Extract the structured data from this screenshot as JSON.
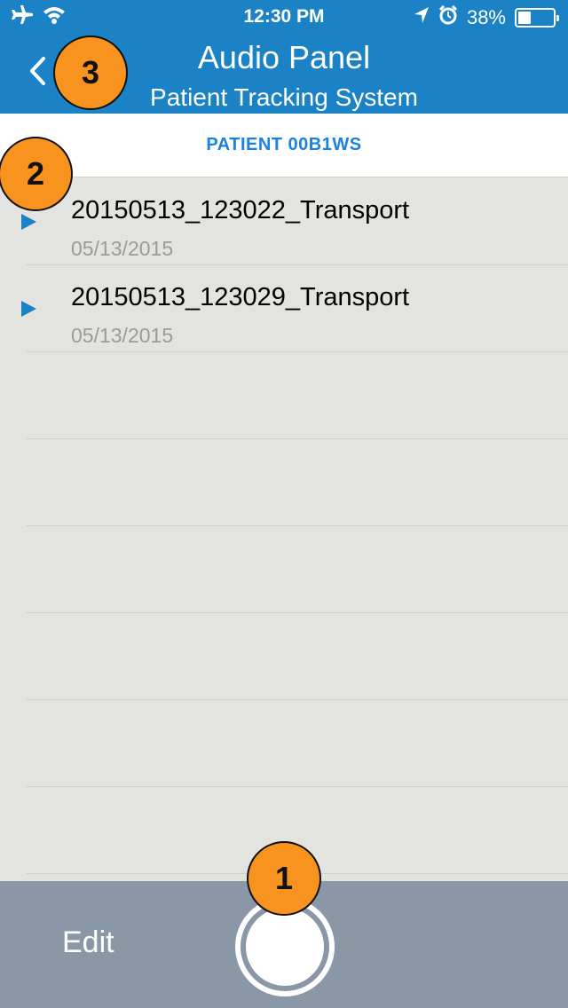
{
  "status_bar": {
    "time": "12:30 PM",
    "battery_percent_label": "38%",
    "battery_level": 0.38,
    "icons": [
      "airplane-icon",
      "wifi-icon",
      "location-icon",
      "alarm-icon",
      "battery-icon"
    ]
  },
  "nav": {
    "title": "Audio Panel",
    "subtitle": "Patient Tracking System",
    "back_icon": "chevron-left-icon"
  },
  "patient": {
    "label": "PATIENT 00B1WS"
  },
  "recordings": [
    {
      "name": "20150513_123022_Transport",
      "date": "05/13/2015"
    },
    {
      "name": "20150513_123029_Transport",
      "date": "05/13/2015"
    }
  ],
  "toolbar": {
    "edit_label": "Edit",
    "record_icon": "record-button-icon"
  },
  "callouts": [
    "1",
    "2",
    "3"
  ],
  "colors": {
    "header": "#1a82c5",
    "accent": "#1a82e0",
    "toolbar": "#8a97a6",
    "callout": "#f7931e",
    "list_bg": "#e3e3e0"
  }
}
